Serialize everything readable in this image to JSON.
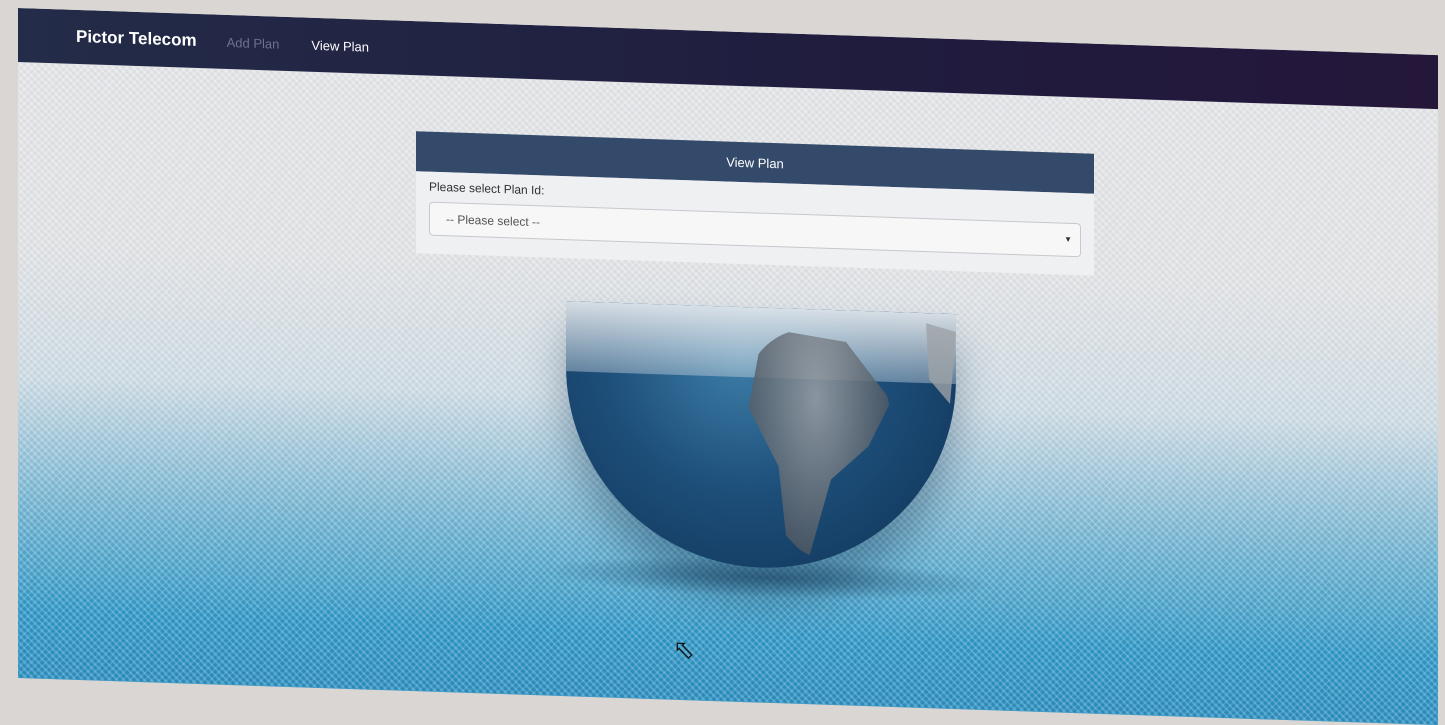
{
  "navbar": {
    "brand": "Pictor Telecom",
    "links": [
      {
        "label": "Add Plan",
        "state": "muted"
      },
      {
        "label": "View Plan",
        "state": "active"
      }
    ]
  },
  "panel": {
    "heading": "View Plan",
    "field_label": "Please select Plan Id:",
    "select": {
      "selected": "-- Please select --"
    }
  },
  "colors": {
    "navbar": "#232c48",
    "panel_heading": "#344a6a",
    "background_bottom": "#2b8fc0"
  },
  "icons": {
    "select_arrow": "caret-down-icon",
    "cursor": "mouse-pointer-icon"
  }
}
